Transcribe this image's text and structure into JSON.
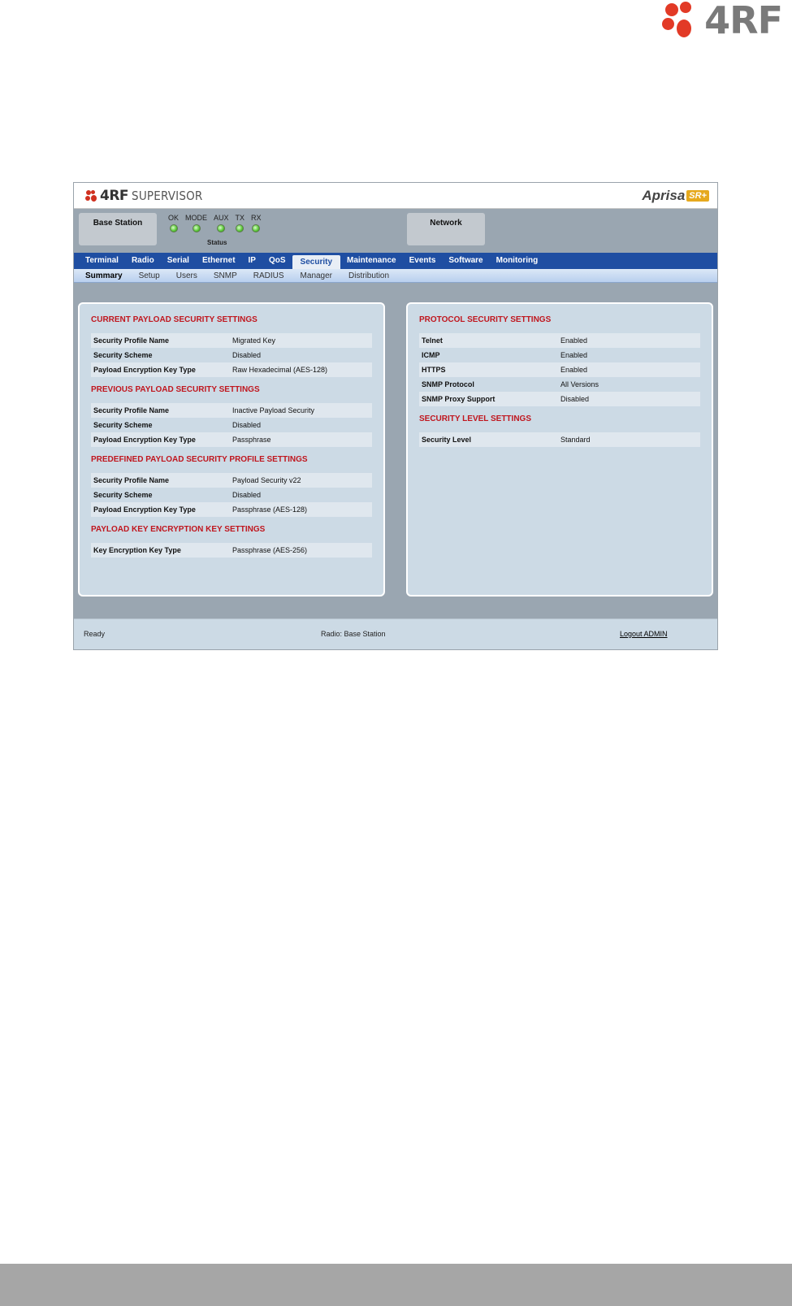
{
  "brand": {
    "name": "4RF"
  },
  "app": {
    "header": {
      "logo_text": "4RF",
      "title": "SUPERVISOR",
      "product": "Aprisa",
      "product_badge": "SR+"
    },
    "status": {
      "station": "Base Station",
      "network": "Network",
      "caption": "Status",
      "leds": [
        {
          "label": "OK",
          "color": "#56c434"
        },
        {
          "label": "MODE",
          "color": "#56c434"
        },
        {
          "label": "AUX",
          "color": "#56c434"
        },
        {
          "label": "TX",
          "color": "#56c434"
        },
        {
          "label": "RX",
          "color": "#56c434"
        }
      ]
    },
    "main_nav": [
      "Terminal",
      "Radio",
      "Serial",
      "Ethernet",
      "IP",
      "QoS",
      "Security",
      "Maintenance",
      "Events",
      "Software",
      "Monitoring"
    ],
    "main_nav_active": "Security",
    "sub_nav": [
      "Summary",
      "Setup",
      "Users",
      "SNMP",
      "RADIUS",
      "Manager",
      "Distribution"
    ],
    "sub_nav_active": "Summary",
    "left_panel": {
      "sections": [
        {
          "title": "CURRENT PAYLOAD SECURITY SETTINGS",
          "rows": [
            {
              "key": "Security Profile Name",
              "value": "Migrated Key"
            },
            {
              "key": "Security Scheme",
              "value": "Disabled"
            },
            {
              "key": "Payload Encryption Key Type",
              "value": "Raw Hexadecimal (AES-128)"
            }
          ]
        },
        {
          "title": "PREVIOUS PAYLOAD SECURITY SETTINGS",
          "rows": [
            {
              "key": "Security Profile Name",
              "value": "Inactive Payload Security"
            },
            {
              "key": "Security Scheme",
              "value": "Disabled"
            },
            {
              "key": "Payload Encryption Key Type",
              "value": "Passphrase"
            }
          ]
        },
        {
          "title": "PREDEFINED PAYLOAD SECURITY PROFILE SETTINGS",
          "rows": [
            {
              "key": "Security Profile Name",
              "value": "Payload Security v22"
            },
            {
              "key": "Security Scheme",
              "value": "Disabled"
            },
            {
              "key": "Payload Encryption Key Type",
              "value": "Passphrase (AES-128)"
            }
          ]
        },
        {
          "title": "PAYLOAD KEY ENCRYPTION KEY SETTINGS",
          "rows": [
            {
              "key": "Key Encryption Key Type",
              "value": "Passphrase (AES-256)"
            }
          ]
        }
      ]
    },
    "right_panel": {
      "sections": [
        {
          "title": "PROTOCOL SECURITY SETTINGS",
          "rows": [
            {
              "key": "Telnet",
              "value": "Enabled"
            },
            {
              "key": "ICMP",
              "value": "Enabled"
            },
            {
              "key": "HTTPS",
              "value": "Enabled"
            },
            {
              "key": "SNMP Protocol",
              "value": "All Versions"
            },
            {
              "key": "SNMP Proxy Support",
              "value": "Disabled"
            }
          ]
        },
        {
          "title": "SECURITY LEVEL SETTINGS",
          "rows": [
            {
              "key": "Security Level",
              "value": "Standard"
            }
          ]
        }
      ]
    },
    "footer": {
      "status": "Ready",
      "radio": "Radio: Base Station",
      "logout": "Logout ADMIN"
    }
  }
}
